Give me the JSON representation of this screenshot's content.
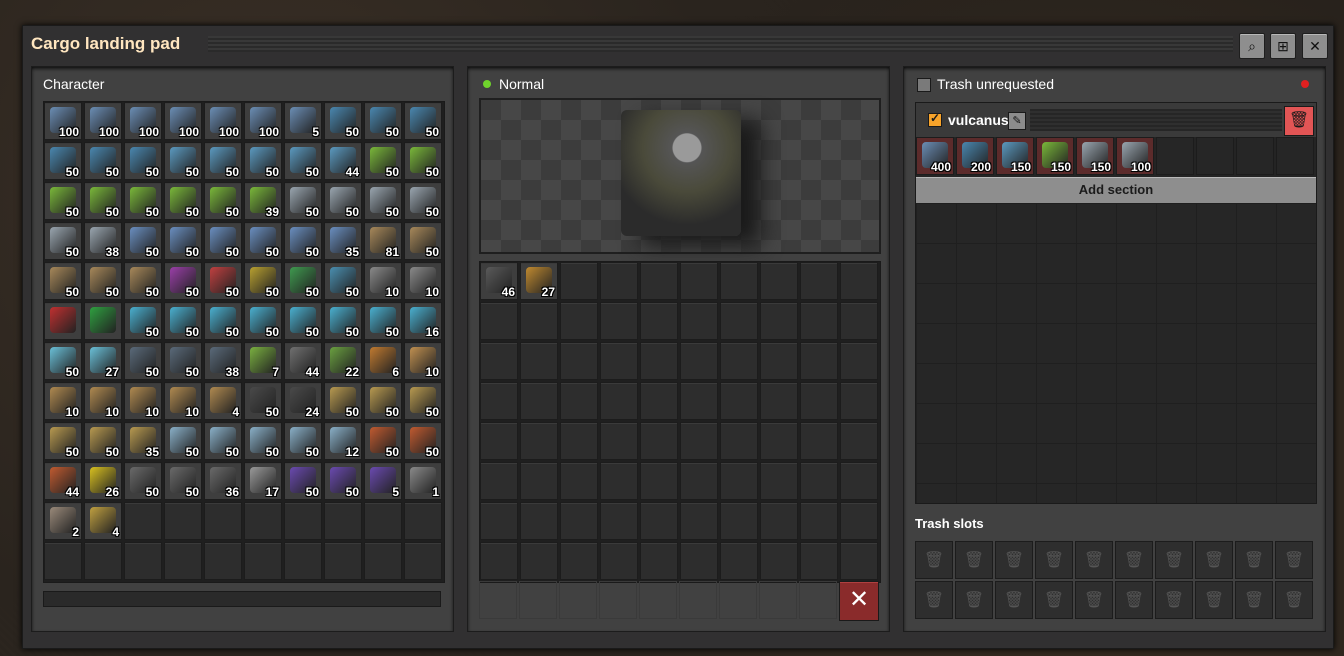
{
  "window": {
    "title": "Cargo landing pad"
  },
  "toolbar": {
    "search_icon": "⌕",
    "network_icon": "⊞",
    "close_icon": "✕"
  },
  "character": {
    "title": "Character",
    "items": [
      {
        "color": "#6b8eb5",
        "count": "100"
      },
      {
        "color": "#6b8eb5",
        "count": "100"
      },
      {
        "color": "#6b8eb5",
        "count": "100"
      },
      {
        "color": "#6b8eb5",
        "count": "100"
      },
      {
        "color": "#6b8eb5",
        "count": "100"
      },
      {
        "color": "#6b8eb5",
        "count": "100"
      },
      {
        "color": "#6b8eb5",
        "count": "5"
      },
      {
        "color": "#4a88b0",
        "count": "50"
      },
      {
        "color": "#4a88b0",
        "count": "50"
      },
      {
        "color": "#4a88b0",
        "count": "50"
      },
      {
        "color": "#4a88b0",
        "count": "50"
      },
      {
        "color": "#4a88b0",
        "count": "50"
      },
      {
        "color": "#4a88b0",
        "count": "50"
      },
      {
        "color": "#5b9ac0",
        "count": "50"
      },
      {
        "color": "#5b9ac0",
        "count": "50"
      },
      {
        "color": "#5b9ac0",
        "count": "50"
      },
      {
        "color": "#5b9ac0",
        "count": "50"
      },
      {
        "color": "#5b9ac0",
        "count": "44"
      },
      {
        "color": "#7ab83a",
        "count": "50"
      },
      {
        "color": "#7ab83a",
        "count": "50"
      },
      {
        "color": "#7ab83a",
        "count": "50"
      },
      {
        "color": "#7ab83a",
        "count": "50"
      },
      {
        "color": "#7ab83a",
        "count": "50"
      },
      {
        "color": "#7ab83a",
        "count": "50"
      },
      {
        "color": "#7ab83a",
        "count": "50"
      },
      {
        "color": "#7ab83a",
        "count": "39"
      },
      {
        "color": "#9aa6b0",
        "count": "50"
      },
      {
        "color": "#9aa6b0",
        "count": "50"
      },
      {
        "color": "#9aa6b0",
        "count": "50"
      },
      {
        "color": "#9aa6b0",
        "count": "50"
      },
      {
        "color": "#9aa6b0",
        "count": "50"
      },
      {
        "color": "#9aa6b0",
        "count": "38"
      },
      {
        "color": "#6a8fc0",
        "count": "50"
      },
      {
        "color": "#6a8fc0",
        "count": "50"
      },
      {
        "color": "#6a8fc0",
        "count": "50"
      },
      {
        "color": "#6a8fc0",
        "count": "50"
      },
      {
        "color": "#6a8fc0",
        "count": "50"
      },
      {
        "color": "#6a8fc0",
        "count": "35"
      },
      {
        "color": "#a8895a",
        "count": "81"
      },
      {
        "color": "#a8895a",
        "count": "50"
      },
      {
        "color": "#a8895a",
        "count": "50"
      },
      {
        "color": "#a8895a",
        "count": "50"
      },
      {
        "color": "#a8895a",
        "count": "50"
      },
      {
        "color": "#9a3fa8",
        "count": "50"
      },
      {
        "color": "#c04040",
        "count": "50"
      },
      {
        "color": "#b8a030",
        "count": "50"
      },
      {
        "color": "#3f9a4f",
        "count": "50"
      },
      {
        "color": "#4a8fb0",
        "count": "50"
      },
      {
        "color": "#8a8a8a",
        "count": "10"
      },
      {
        "color": "#8a8a8a",
        "count": "10"
      },
      {
        "color": "#c03030",
        "count": ""
      },
      {
        "color": "#2fa040",
        "count": ""
      },
      {
        "color": "#4ab0d0",
        "count": "50"
      },
      {
        "color": "#4ab0d0",
        "count": "50"
      },
      {
        "color": "#4ab0d0",
        "count": "50"
      },
      {
        "color": "#4ab0d0",
        "count": "50"
      },
      {
        "color": "#4ab0d0",
        "count": "50"
      },
      {
        "color": "#4ab0d0",
        "count": "50"
      },
      {
        "color": "#4ab0d0",
        "count": "50"
      },
      {
        "color": "#4ab0d0",
        "count": "16"
      },
      {
        "color": "#6ac0d8",
        "count": "50"
      },
      {
        "color": "#6ac0d8",
        "count": "27"
      },
      {
        "color": "#5a6a7a",
        "count": "50"
      },
      {
        "color": "#5a6a7a",
        "count": "50"
      },
      {
        "color": "#5a6a7a",
        "count": "38"
      },
      {
        "color": "#7ab040",
        "count": "7"
      },
      {
        "color": "#707070",
        "count": "44"
      },
      {
        "color": "#6aa040",
        "count": "22"
      },
      {
        "color": "#c07a30",
        "count": "6"
      },
      {
        "color": "#c09050",
        "count": "10"
      },
      {
        "color": "#b08a50",
        "count": "10"
      },
      {
        "color": "#b08a50",
        "count": "10"
      },
      {
        "color": "#b08a50",
        "count": "10"
      },
      {
        "color": "#b08a50",
        "count": "10"
      },
      {
        "color": "#b08a50",
        "count": "4"
      },
      {
        "color": "#4a4a4a",
        "count": "50"
      },
      {
        "color": "#4a4a4a",
        "count": "24"
      },
      {
        "color": "#b89a50",
        "count": "50"
      },
      {
        "color": "#b89a50",
        "count": "50"
      },
      {
        "color": "#b89a50",
        "count": "50"
      },
      {
        "color": "#b89a50",
        "count": "50"
      },
      {
        "color": "#b89a50",
        "count": "50"
      },
      {
        "color": "#b89a50",
        "count": "35"
      },
      {
        "color": "#8ab0c8",
        "count": "50"
      },
      {
        "color": "#8ab0c8",
        "count": "50"
      },
      {
        "color": "#8ab0c8",
        "count": "50"
      },
      {
        "color": "#8ab0c8",
        "count": "50"
      },
      {
        "color": "#8ab0c8",
        "count": "12"
      },
      {
        "color": "#c05a30",
        "count": "50"
      },
      {
        "color": "#c05a30",
        "count": "50"
      },
      {
        "color": "#c05a30",
        "count": "44"
      },
      {
        "color": "#d8c020",
        "count": "26"
      },
      {
        "color": "#6a6a6a",
        "count": "50"
      },
      {
        "color": "#6a6a6a",
        "count": "50"
      },
      {
        "color": "#6a6a6a",
        "count": "36"
      },
      {
        "color": "#9a9a9a",
        "count": "17"
      },
      {
        "color": "#6a4ab0",
        "count": "50"
      },
      {
        "color": "#6a4ab0",
        "count": "50"
      },
      {
        "color": "#6a4ab0",
        "count": "5"
      },
      {
        "color": "#8a8a8a",
        "count": "1"
      },
      {
        "color": "#9a8a7a",
        "count": "2"
      },
      {
        "color": "#c0a040",
        "count": "4"
      }
    ],
    "total_slots": 120
  },
  "pad": {
    "status_label": "Normal",
    "status_color": "#6fd42c",
    "items": [
      {
        "color": "#5a5a5a",
        "count": "46"
      },
      {
        "color": "#c08a30",
        "count": "27"
      }
    ],
    "total_slots": 80,
    "trash_slots": 10,
    "clear_icon": "✕"
  },
  "logistics": {
    "trash_unrequested_label": "Trash unrequested",
    "indicator_color": "#e02020",
    "section": {
      "name": "vulcanus",
      "edit_icon": "✎",
      "delete_icon": "🗑",
      "requests": [
        {
          "color": "#6b8eb5",
          "count": "400"
        },
        {
          "color": "#4a88b0",
          "count": "200"
        },
        {
          "color": "#5b9ac0",
          "count": "150"
        },
        {
          "color": "#7ab83a",
          "count": "150"
        },
        {
          "color": "#9aa6b0",
          "count": "150"
        },
        {
          "color": "#9aa6b0",
          "count": "100"
        }
      ],
      "total_slots": 10
    },
    "add_section_label": "Add section",
    "trash_slots_label": "Trash slots",
    "trash_slot_count": 20,
    "trash_slot_icon": "🗑"
  }
}
